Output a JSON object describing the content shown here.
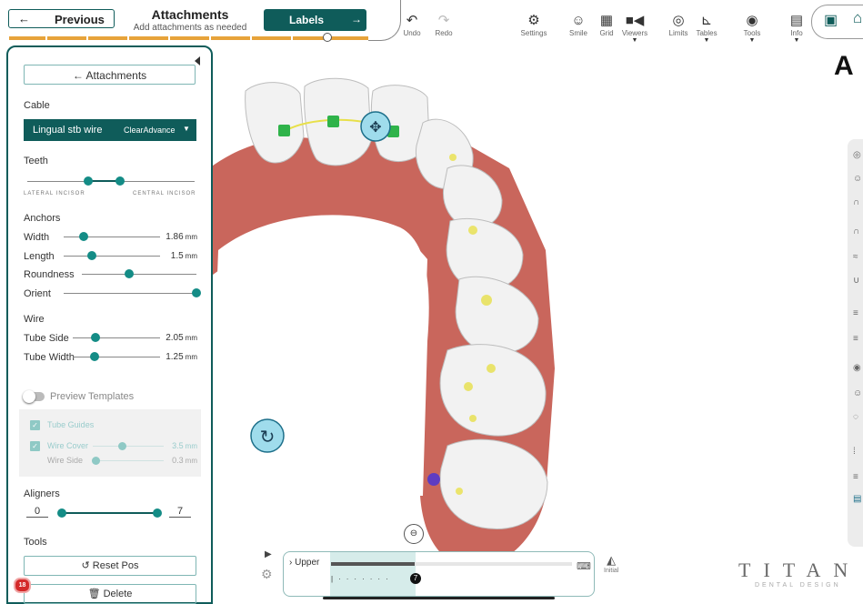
{
  "header": {
    "prev_label": "Previous",
    "prev_arrow": "←",
    "step_title": "Attachments",
    "step_subtitle": "Add attachments as needed",
    "next_label": "Labels",
    "next_arrow": "→",
    "progress_fraction": 0.88
  },
  "toolbar": {
    "undo": "Undo",
    "redo": "Redo",
    "settings": "Settings",
    "smile": "Smile",
    "grid": "Grid",
    "viewers": "Viewers",
    "limits": "Limits",
    "tables": "Tables",
    "tools": "Tools",
    "info": "Info"
  },
  "view_letter": "A",
  "panel": {
    "back_label": "Attachments",
    "cable": {
      "heading": "Cable",
      "wire_value": "Lingual stb wire",
      "brand_value": "ClearAdvance"
    },
    "teeth": {
      "heading": "Teeth",
      "left_label": "LATERAL INCISOR",
      "right_label": "CENTRAL INCISOR"
    },
    "anchors": {
      "heading": "Anchors",
      "width_label": "Width",
      "width_value": "1.86",
      "length_label": "Length",
      "length_value": "1.5",
      "roundness_label": "Roundness",
      "orient_label": "Orient",
      "unit": "mm"
    },
    "wire": {
      "heading": "Wire",
      "tube_side_label": "Tube Side",
      "tube_side_value": "2.05",
      "tube_width_label": "Tube Width",
      "tube_width_value": "1.25",
      "unit": "mm"
    },
    "preview_templates": "Preview Templates",
    "tube_guides": "Tube Guides",
    "wire_cover": "Wire Cover",
    "wire_cover_value": "3.5",
    "wire_side": "Wire Side",
    "wire_side_value": "0.3",
    "aligners": {
      "heading": "Aligners",
      "from": "0",
      "to": "7"
    },
    "tools": {
      "heading": "Tools",
      "reset_label": "Reset Pos",
      "delete_label": "Delete"
    },
    "notification_count": "18"
  },
  "timeline": {
    "arch_label": "Upper",
    "current_stage": "7",
    "initial_label": "Initial"
  },
  "logo": {
    "text": "TITAN",
    "subtitle": "DENTAL DESIGN"
  },
  "colors": {
    "accent": "#0f5c5a",
    "knob": "#148c86",
    "progress": "#e7a33a",
    "gum": "#c9665c",
    "tooth": "#f2f2f2",
    "highlight": "#e8e04a"
  }
}
